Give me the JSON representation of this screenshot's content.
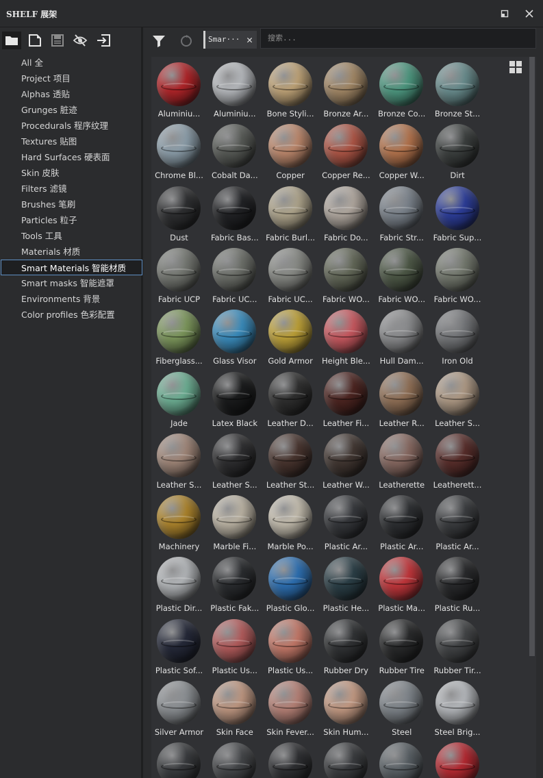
{
  "window": {
    "title": "SHELF 展架"
  },
  "toolbar": {
    "icons": [
      "folder-icon",
      "new-document-icon",
      "save-icon",
      "hidden-icon",
      "import-icon"
    ]
  },
  "categories": [
    "All 全",
    "Project 项目",
    "Alphas 透贴",
    "Grunges 脏迹",
    "Procedurals 程序纹理",
    "Textures 贴图",
    "Hard Surfaces 硬表面",
    "Skin 皮肤",
    "Filters 滤镜",
    "Brushes 笔刷",
    "Particles 粒子",
    "Tools 工具",
    "Materials 材质",
    "Smart Materials 智能材质",
    "Smart masks 智能遮罩",
    "Environments 背景",
    "Color profiles 色彩配置"
  ],
  "selected_category": "Smart Materials 智能材质",
  "filter_bar": {
    "tag_label": "Smar···",
    "search_placeholder": "搜索..."
  },
  "materials": [
    {
      "label": "Aluminiu...",
      "color": "#b3262a"
    },
    {
      "label": "Aluminiu...",
      "color": "#b9bcc0"
    },
    {
      "label": "Bone Styli...",
      "color": "#c2a67a"
    },
    {
      "label": "Bronze Ar...",
      "color": "#a58a68"
    },
    {
      "label": "Bronze Co...",
      "color": "#4f9a82"
    },
    {
      "label": "Bronze St...",
      "color": "#6b8f90"
    },
    {
      "label": "Chrome Bl...",
      "color": "#8fa1ad"
    },
    {
      "label": "Cobalt Da...",
      "color": "#595c58"
    },
    {
      "label": "Copper",
      "color": "#c08b6f"
    },
    {
      "label": "Copper Re...",
      "color": "#b15848"
    },
    {
      "label": "Copper W...",
      "color": "#b7764f"
    },
    {
      "label": "Dirt",
      "color": "#3d4140"
    },
    {
      "label": "Dust",
      "color": "#2f3032"
    },
    {
      "label": "Fabric Bas...",
      "color": "#222326"
    },
    {
      "label": "Fabric Burl...",
      "color": "#b2a88f"
    },
    {
      "label": "Fabric Do...",
      "color": "#b4aba2"
    },
    {
      "label": "Fabric Str...",
      "color": "#7d858e"
    },
    {
      "label": "Fabric Sup...",
      "color": "#2e3f9c"
    },
    {
      "label": "Fabric UCP",
      "color": "#777a74"
    },
    {
      "label": "Fabric UC...",
      "color": "#6f726c"
    },
    {
      "label": "Fabric UC...",
      "color": "#8a8c87"
    },
    {
      "label": "Fabric WO...",
      "color": "#656a5a"
    },
    {
      "label": "Fabric WO...",
      "color": "#4f5a48"
    },
    {
      "label": "Fabric WO...",
      "color": "#767b70"
    },
    {
      "label": "Fiberglass...",
      "color": "#7f9a5e"
    },
    {
      "label": "Glass Visor",
      "color": "#3c8fc0"
    },
    {
      "label": "Gold Armor",
      "color": "#c1a43a"
    },
    {
      "label": "Height Ble...",
      "color": "#cc5b62"
    },
    {
      "label": "Hull Dam...",
      "color": "#8d8e90"
    },
    {
      "label": "Iron Old",
      "color": "#76787b"
    },
    {
      "label": "Jade",
      "color": "#6fb296"
    },
    {
      "label": "Latex Black",
      "color": "#1b1c1d"
    },
    {
      "label": "Leather D...",
      "color": "#303030"
    },
    {
      "label": "Leather Fi...",
      "color": "#4e2622"
    },
    {
      "label": "Leather R...",
      "color": "#937258"
    },
    {
      "label": "Leather S...",
      "color": "#b29d88"
    },
    {
      "label": "Leather S...",
      "color": "#a3897b"
    },
    {
      "label": "Leather S...",
      "color": "#2f2f31"
    },
    {
      "label": "Leather St...",
      "color": "#4a3630"
    },
    {
      "label": "Leather W...",
      "color": "#433833"
    },
    {
      "label": "Leatherette",
      "color": "#8a6b63"
    },
    {
      "label": "Leatherett...",
      "color": "#5a2f2c"
    },
    {
      "label": "Machinery",
      "color": "#b0872e"
    },
    {
      "label": "Marble Fi...",
      "color": "#bfb7a7"
    },
    {
      "label": "Marble Po...",
      "color": "#c7c0b1"
    },
    {
      "label": "Plastic Ar...",
      "color": "#37393d"
    },
    {
      "label": "Plastic Ar...",
      "color": "#2e3033"
    },
    {
      "label": "Plastic Ar...",
      "color": "#3c3e41"
    },
    {
      "label": "Plastic Dir...",
      "color": "#b6b9bc"
    },
    {
      "label": "Plastic Fak...",
      "color": "#2b2d30"
    },
    {
      "label": "Plastic Glo...",
      "color": "#2f72b5"
    },
    {
      "label": "Plastic He...",
      "color": "#2c4048"
    },
    {
      "label": "Plastic Ma...",
      "color": "#c5383d"
    },
    {
      "label": "Plastic Ru...",
      "color": "#2a2b2d"
    },
    {
      "label": "Plastic Sof...",
      "color": "#262a3a"
    },
    {
      "label": "Plastic Us...",
      "color": "#b65e5e"
    },
    {
      "label": "Plastic Us...",
      "color": "#c77b6b"
    },
    {
      "label": "Rubber Dry",
      "color": "#323436"
    },
    {
      "label": "Rubber Tire",
      "color": "#2a2b2c"
    },
    {
      "label": "Rubber Tir...",
      "color": "#444648"
    },
    {
      "label": "Silver Armor",
      "color": "#8e9296"
    },
    {
      "label": "Skin Face",
      "color": "#c29a84"
    },
    {
      "label": "Skin Fever...",
      "color": "#b98479"
    },
    {
      "label": "Skin Hum...",
      "color": "#c79d86"
    },
    {
      "label": "Steel",
      "color": "#81878d"
    },
    {
      "label": "Steel Brig...",
      "color": "#b8bbbf"
    },
    {
      "label": "",
      "color": "#3a3c3f"
    },
    {
      "label": "",
      "color": "#45474a"
    },
    {
      "label": "",
      "color": "#2f3033"
    },
    {
      "label": "",
      "color": "#3b3d40"
    },
    {
      "label": "",
      "color": "#5a6166"
    },
    {
      "label": "",
      "color": "#b82b33"
    }
  ]
}
